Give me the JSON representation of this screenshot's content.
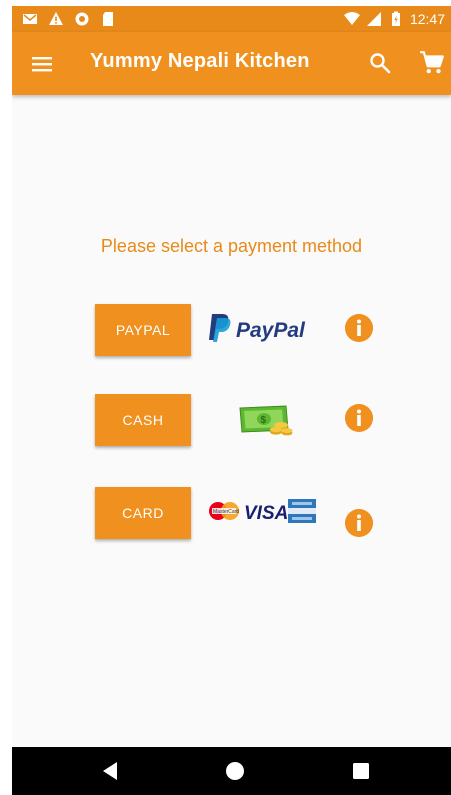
{
  "status_bar": {
    "time": "12:47",
    "left_icons": [
      "gmail-icon",
      "warning-icon",
      "circle-icon",
      "sd-card-icon"
    ],
    "right_icons": [
      "wifi-icon",
      "signal-icon",
      "battery-icon"
    ]
  },
  "app_bar": {
    "title": "Yummy Nepali Kitchen",
    "menu_icon": "menu-icon",
    "search_icon": "search-icon",
    "cart_icon": "cart-icon"
  },
  "content": {
    "prompt": "Please select a payment method",
    "methods": [
      {
        "label": "PAYPAL",
        "logo": "paypal-logo",
        "logo_text": "PayPal"
      },
      {
        "label": "CASH",
        "logo": "cash-money-icon"
      },
      {
        "label": "CARD",
        "logo": "card-logos",
        "logo_text": "VISA"
      }
    ]
  },
  "nav_bar": {
    "back": "back-icon",
    "home": "home-icon",
    "recents": "recents-icon"
  },
  "colors": {
    "accent": "#f0901e",
    "status_bar": "#e88a1a",
    "background": "#fafafa",
    "nav_bar": "#000000"
  }
}
